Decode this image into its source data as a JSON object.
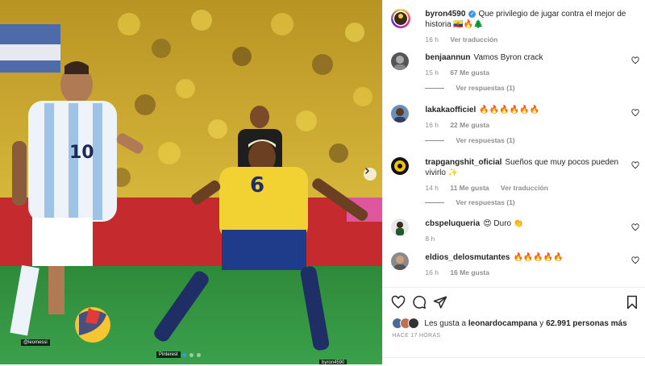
{
  "post": {
    "author": "byron4590",
    "verified": true,
    "caption": "Que privilegio de jugar contra el mejor de historia 🇪🇨🔥🌲",
    "time": "16 h",
    "translate": "Ver traducción"
  },
  "comments": [
    {
      "user": "benjaannun",
      "text": "Vamos Byron crack",
      "time": "15 h",
      "likes": "67 Me gusta",
      "reply": "",
      "translate": "",
      "replies": "Ver respuestas (1)"
    },
    {
      "user": "lakakaofficiel",
      "text": "🔥🔥🔥🔥🔥🔥",
      "time": "16 h",
      "likes": "22 Me gusta",
      "reply": "",
      "translate": "",
      "replies": "Ver respuestas (1)"
    },
    {
      "user": "trapgangshit_oficial",
      "text": "Sueños que muy pocos pueden vivirlo ✨",
      "time": "14 h",
      "likes": "11 Me gusta",
      "reply": "",
      "translate": "Ver traducción",
      "replies": "Ver respuestas (1)"
    },
    {
      "user": "cbspeluqueria",
      "text": "😍 Duro 👏",
      "time": "8 h",
      "likes": "",
      "reply": "",
      "translate": "",
      "replies": ""
    },
    {
      "user": "eldios_delosmutantes",
      "text": "🔥🔥🔥🔥🔥",
      "time": "16 h",
      "likes": "16 Me gusta",
      "reply": "",
      "translate": "",
      "replies": ""
    }
  ],
  "likes_line": {
    "prefix": "Les gusta a",
    "user": "leonardocampana",
    "connector": "y",
    "count": "62.991 personas más"
  },
  "time_ago": "HACE 17 HORAS",
  "media": {
    "watermark_left": "@leomessi",
    "watermark_mid": "Pinterest",
    "watermark_right": "byron4590",
    "jersey_left": "10",
    "jersey_right": "6",
    "carousel_count": 3,
    "carousel_active": 0
  },
  "colors": {
    "accent": "#3897f0",
    "muted": "#8e8e8e",
    "text": "#262626"
  },
  "icons": [
    "heart-icon",
    "comment-icon",
    "share-icon",
    "bookmark-icon",
    "chevron-right-icon",
    "verified-icon"
  ]
}
